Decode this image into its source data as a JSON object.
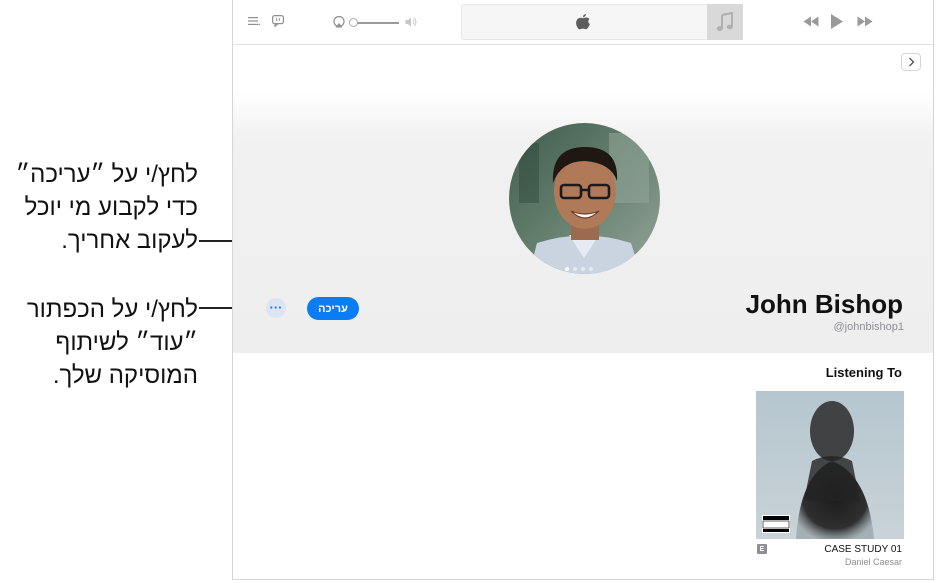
{
  "callouts": {
    "edit": [
      "לחץ/י על ״עריכה״",
      "כדי לקבוע מי יוכל",
      "לעקוב אחריך."
    ],
    "more": [
      "לחץ/י על הכפתור",
      "״עוד״ לשיתוף",
      "המוסיקה שלך."
    ]
  },
  "profile": {
    "name": "John Bishop",
    "handle": "@johnbishop1",
    "edit_label": "עריכה",
    "more_label": "···"
  },
  "listening": {
    "title": "Listening To",
    "album": "CASE STUDY 01",
    "artist": "Daniel Caesar",
    "explicit_badge": "E"
  },
  "toolbar": {
    "icons": [
      "list-icon",
      "lyrics-icon",
      "airplay-icon",
      "volume-icon",
      "apple-logo-icon",
      "music-note-icon",
      "rewind-icon",
      "play-icon",
      "forward-icon"
    ]
  },
  "colors": {
    "accent": "#0a7cf5",
    "secondary_text": "#8e8e93"
  }
}
